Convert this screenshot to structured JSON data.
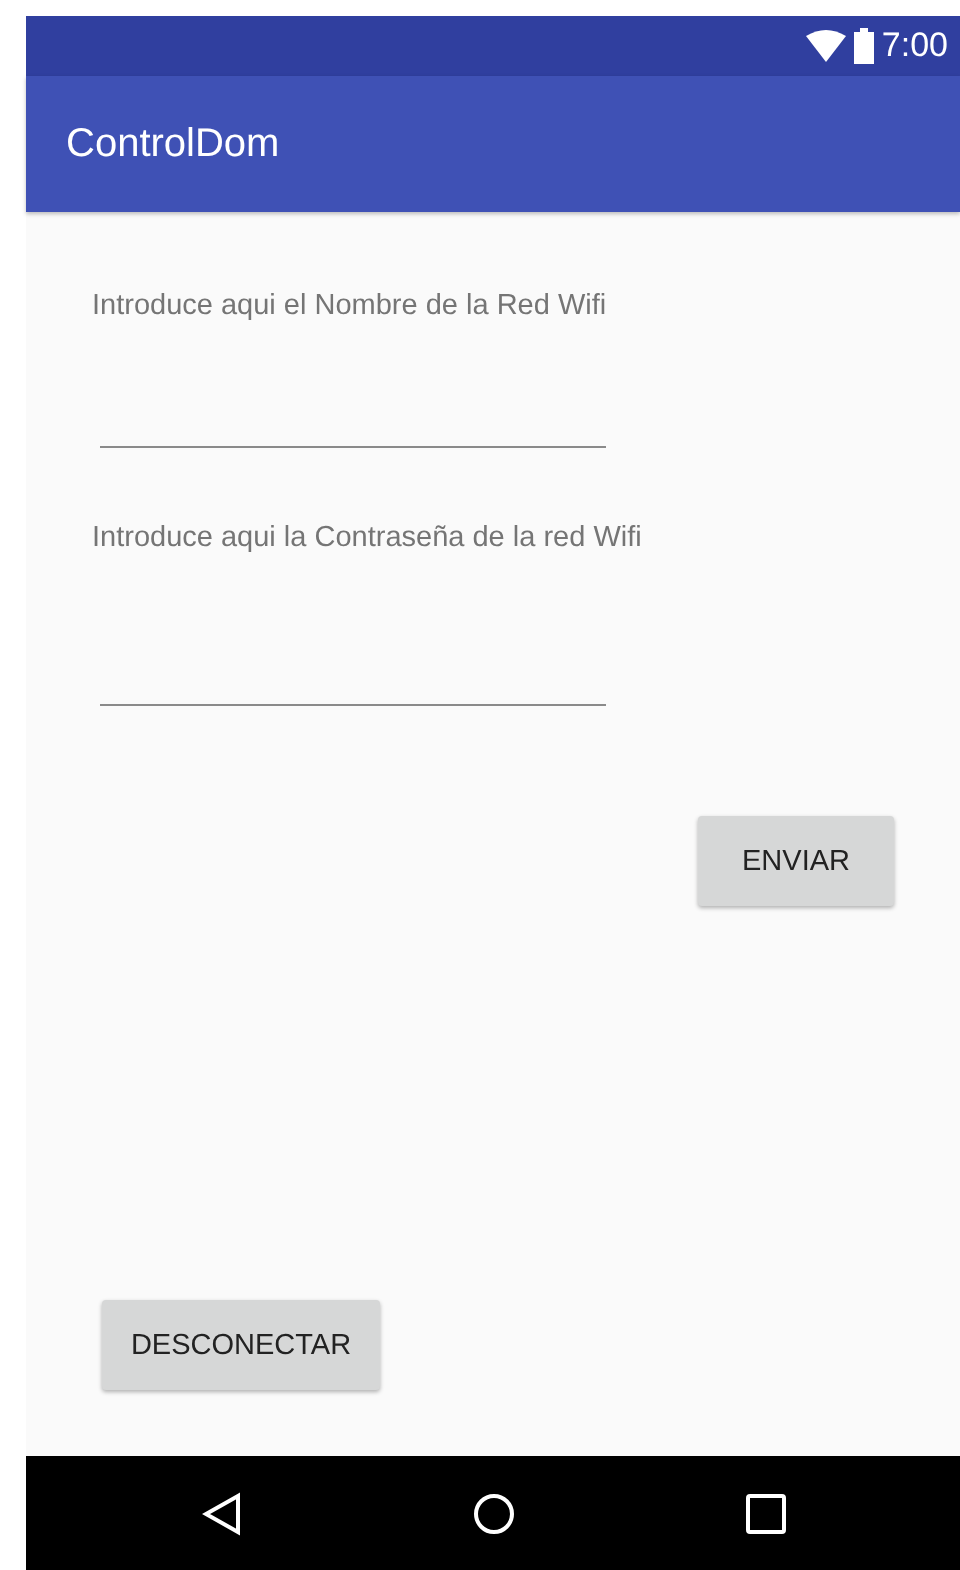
{
  "status_bar": {
    "time": "7:00"
  },
  "app_bar": {
    "title": "ControlDom"
  },
  "fields": [
    {
      "label": "Introduce aqui el Nombre de la Red Wifi"
    },
    {
      "label": "Introduce aqui la Contraseña de la red Wifi"
    }
  ],
  "send_button": {
    "label": "ENVIAR"
  },
  "disconnect_button": {
    "label": "DESCONECTAR"
  }
}
